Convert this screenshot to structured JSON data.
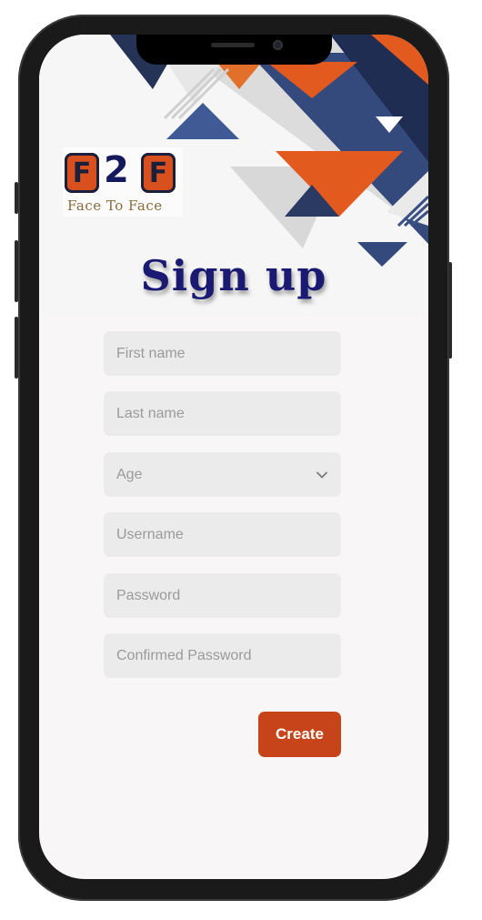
{
  "app": {
    "logo_text": "F2F",
    "logo_tagline": "Face To Face"
  },
  "page_title": "Sign up",
  "form": {
    "first_name": {
      "placeholder": "First name",
      "value": ""
    },
    "last_name": {
      "placeholder": "Last name",
      "value": ""
    },
    "age": {
      "selected": "Age",
      "icon": "chevron-down-icon"
    },
    "username": {
      "placeholder": "Username",
      "value": ""
    },
    "password": {
      "placeholder": "Password",
      "value": ""
    },
    "confirm_password": {
      "placeholder": "Confirmed Password",
      "value": ""
    },
    "create_label": "Create"
  },
  "colors": {
    "accent": "#c7441a",
    "title": "#1b1a72",
    "navy": "#34497c",
    "field_bg": "#ebebeb"
  }
}
